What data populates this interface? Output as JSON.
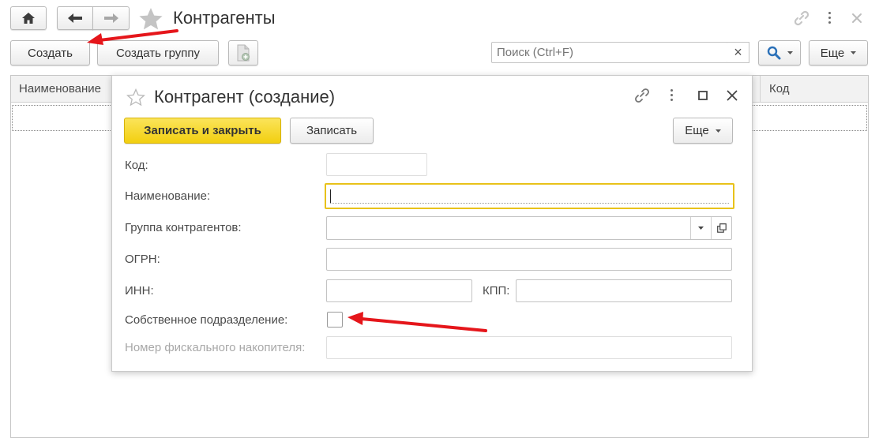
{
  "window": {
    "title": "Контрагенты",
    "create_label": "Создать",
    "create_group_label": "Создать группу",
    "search_placeholder": "Поиск (Ctrl+F)",
    "search_clear": "×",
    "more_label": "Еще",
    "columns": [
      "Наименование",
      "Код"
    ]
  },
  "dialog": {
    "title": "Контрагент (создание)",
    "save_close_label": "Записать и закрыть",
    "save_label": "Записать",
    "more_label": "Еще",
    "fields": {
      "code": "Код:",
      "name": "Наименование:",
      "group": "Группа контрагентов:",
      "ogrn": "ОГРН:",
      "inn": "ИНН:",
      "kpp": "КПП:",
      "own_division": "Собственное подразделение:",
      "fiscal_number": "Номер фискального накопителя:"
    },
    "values": {
      "code": "",
      "name": "",
      "group": "",
      "ogrn": "",
      "inn": "",
      "kpp": "",
      "fiscal_number": ""
    },
    "own_division_checked": false
  },
  "colors": {
    "accent_yellow": "#f5d51c",
    "focus_border": "#e8c21a",
    "annotation_arrow": "#e5161b"
  }
}
